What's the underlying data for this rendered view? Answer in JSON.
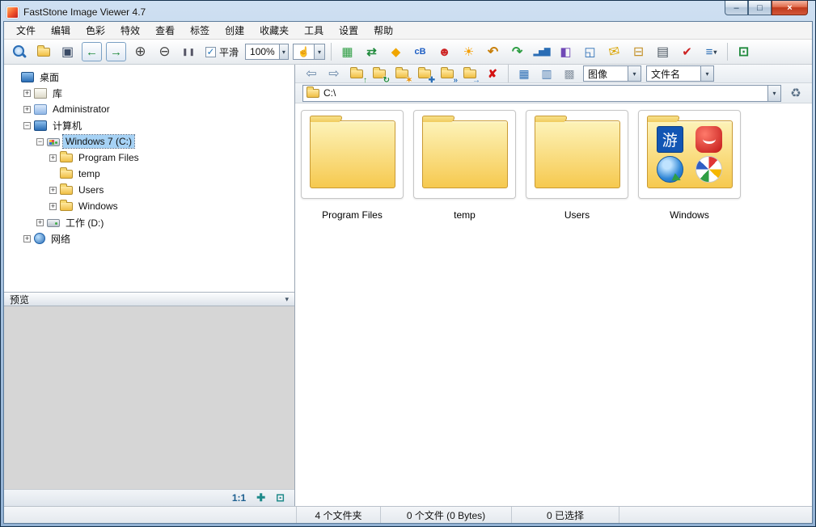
{
  "window": {
    "title": "FastStone Image Viewer 4.7"
  },
  "icons": {
    "min": "–",
    "max": "□",
    "close": "×",
    "save": "▣",
    "back": "←",
    "forward": "→",
    "zoom_in": "⊕",
    "zoom_out": "⊖",
    "actual_size": "❚❚",
    "hand": "☝",
    "dropdown": "▾",
    "slideshow": "▦",
    "convert": "⇄",
    "tag": "◆",
    "clipboard": "cB",
    "red_eye": "☻",
    "enhance": "☀",
    "rotate_left": "↶",
    "rotate_right": "↷",
    "histogram": "▂▅▇",
    "compare": "◧",
    "capture": "◱",
    "email": "✉",
    "acquire": "⊟",
    "print": "▤",
    "check": "✔",
    "options": "≡",
    "fullscreen": "⊡",
    "nav_back": "⇦",
    "nav_forward": "⇨",
    "up": "↑",
    "refresh": "↻",
    "favorite": "✶",
    "paste": "✚",
    "copy_to": "»",
    "move_to": "→",
    "delete": "✘",
    "view_thumbs": "▦",
    "view_list": "▥",
    "view_detail": "▩",
    "trash": "♻",
    "collapse": "▾",
    "fit": "✚",
    "frame": "⊡"
  },
  "menu": {
    "items": [
      "文件",
      "编辑",
      "色彩",
      "特效",
      "查看",
      "标签",
      "创建",
      "收藏夹",
      "工具",
      "设置",
      "帮助"
    ]
  },
  "toolbar": {
    "smooth_label": "平滑",
    "zoom_value": "100%"
  },
  "tree": {
    "items": [
      "桌面",
      "库",
      "Administrator",
      "计算机",
      "Windows 7 (C:)",
      "Program Files",
      "temp",
      "Users",
      "Windows",
      "工作 (D:)",
      "网络"
    ]
  },
  "preview": {
    "label": "预览",
    "ratio": "1:1"
  },
  "browser": {
    "address": "C:\\",
    "view_mode": "图像",
    "sort_mode": "文件名",
    "windows_badge": "游",
    "items": [
      {
        "name": "Program Files"
      },
      {
        "name": "temp"
      },
      {
        "name": "Users"
      },
      {
        "name": "Windows"
      }
    ]
  },
  "statusbar": {
    "folders": "4 个文件夹",
    "files": "0 个文件 (0 Bytes)",
    "selected": "0 已选择"
  }
}
